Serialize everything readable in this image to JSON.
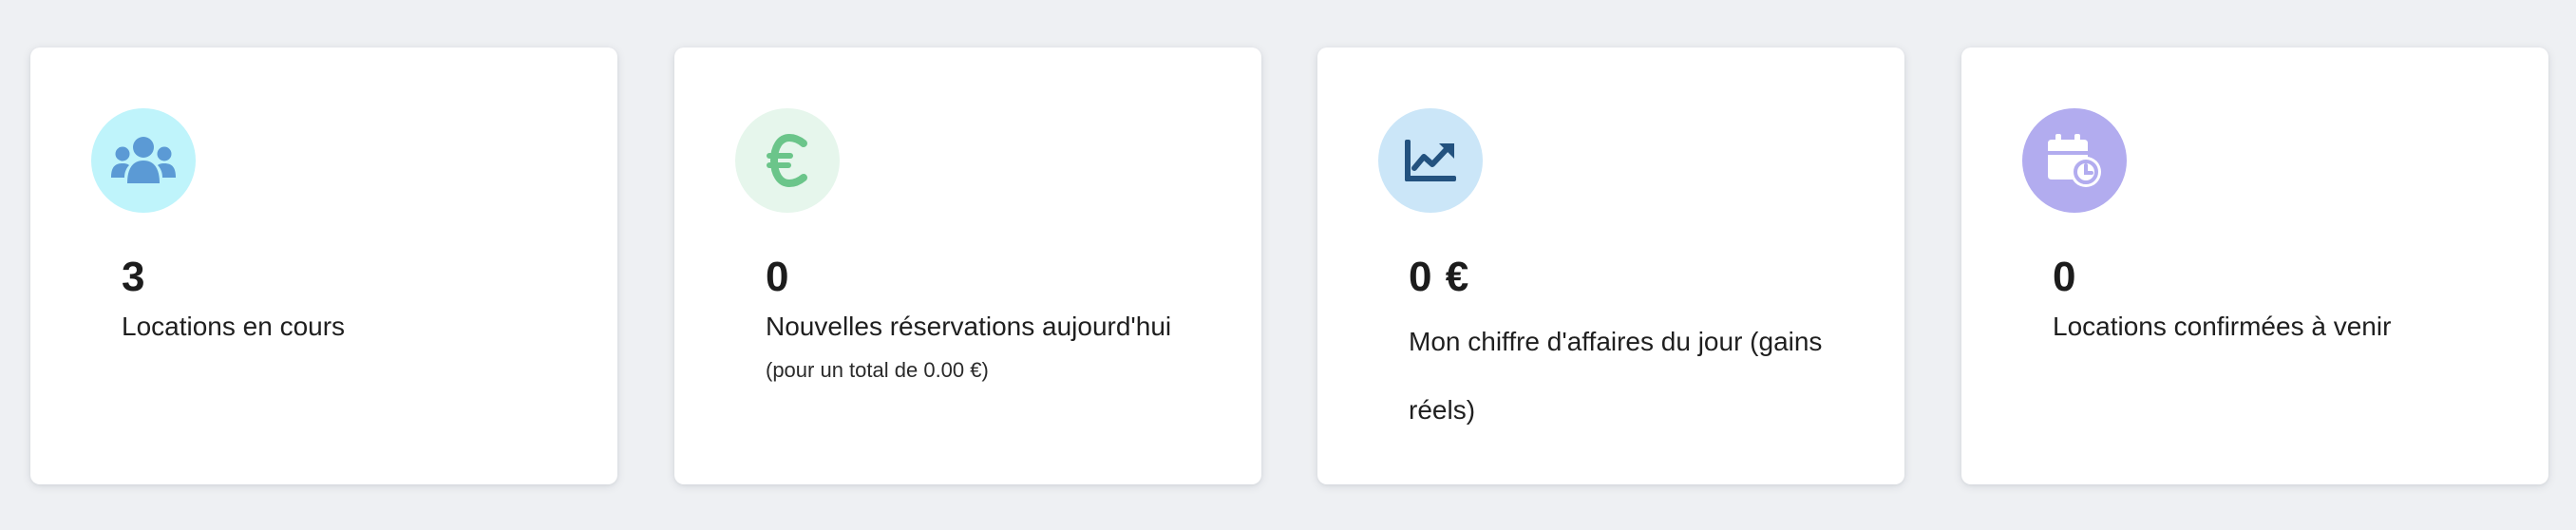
{
  "cards": [
    {
      "icon": "users-icon",
      "icon_bg": "#bff4fb",
      "icon_color": "#5b9ad5",
      "value": "3",
      "label": "Locations en cours"
    },
    {
      "icon": "euro-icon",
      "icon_bg": "#e6f6ec",
      "icon_color": "#6bc58a",
      "value": "0",
      "label": "Nouvelles réservations aujourd'hui",
      "sub": "(pour un total de 0.00 €)"
    },
    {
      "icon": "chart-line-icon",
      "icon_bg": "#cbe6f8",
      "icon_color": "#23527f",
      "value": "0 €",
      "label": "Mon chiffre d'affaires du jour (gains réels)"
    },
    {
      "icon": "calendar-clock-icon",
      "icon_bg": "#b2acef",
      "icon_color": "#ffffff",
      "value": "0",
      "label": "Locations confirmées à venir"
    }
  ]
}
